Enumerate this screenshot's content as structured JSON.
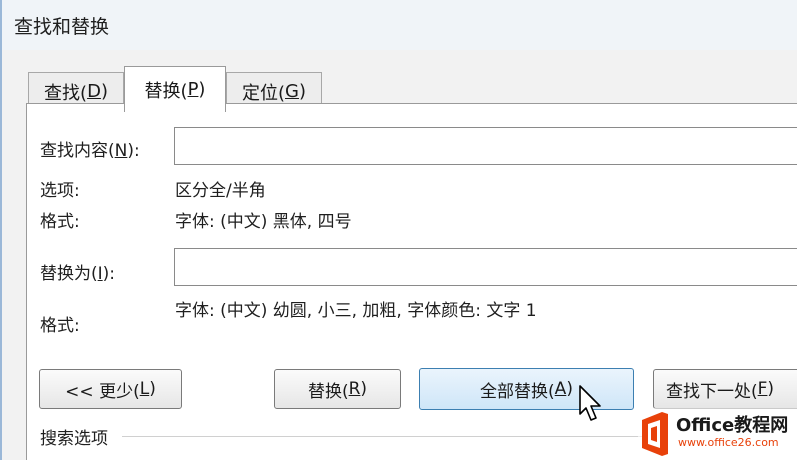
{
  "window": {
    "title": "查找和替换"
  },
  "tabs": [
    {
      "text": "查找(",
      "key": "D",
      "end": ")"
    },
    {
      "text": "替换(",
      "key": "P",
      "end": ")"
    },
    {
      "text": "定位(",
      "key": "G",
      "end": ")"
    }
  ],
  "find": {
    "label_text": "查找内容(",
    "label_key": "N",
    "label_end": "):",
    "value": ""
  },
  "options": {
    "label": "选项:",
    "value": "区分全/半角"
  },
  "find_format": {
    "label": "格式:",
    "value": "字体: (中文) 黑体, 四号"
  },
  "replace": {
    "label_text": "替换为(",
    "label_key": "I",
    "label_end": "):",
    "value": ""
  },
  "replace_format": {
    "label": "格式:",
    "value": "字体: (中文) 幼圆, 小三, 加粗, 字体颜色: 文字 1"
  },
  "buttons": {
    "less": {
      "text": "<< 更少(",
      "key": "L",
      "end": ")"
    },
    "replace": {
      "text": "替换(",
      "key": "R",
      "end": ")"
    },
    "replace_all": {
      "text": "全部替换(",
      "key": "A",
      "end": ")"
    },
    "find_next": {
      "text": "查找下一处(",
      "key": "F",
      "end": ")"
    }
  },
  "search_options": {
    "label": "搜索选项"
  },
  "watermark": {
    "brand": "Office教程网",
    "url": "www.office26.com"
  },
  "colors": {
    "accent": "#3c7fb1",
    "logo": "#e8410a"
  }
}
